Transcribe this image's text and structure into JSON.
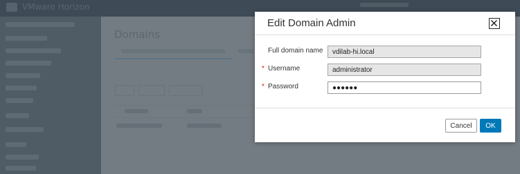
{
  "app": {
    "product_name": "VMware Horizon",
    "page_title": "Domains"
  },
  "dialog": {
    "title": "Edit Domain Admin",
    "fields": [
      {
        "label": "Full domain name",
        "value": "vdilab-hi.local",
        "required": false,
        "readonly": true
      },
      {
        "label": "Username",
        "value": "administrator",
        "required": true,
        "readonly": true
      },
      {
        "label": "Password",
        "value": "●●●●●●",
        "required": true,
        "readonly": false
      }
    ],
    "required_marker": "*",
    "cancel_label": "Cancel",
    "ok_label": "OK"
  },
  "colors": {
    "primary_button": "#0079b8",
    "required_marker": "#c92100",
    "overlay_background": "#6f7880"
  },
  "icons": {
    "close": "close-icon"
  }
}
